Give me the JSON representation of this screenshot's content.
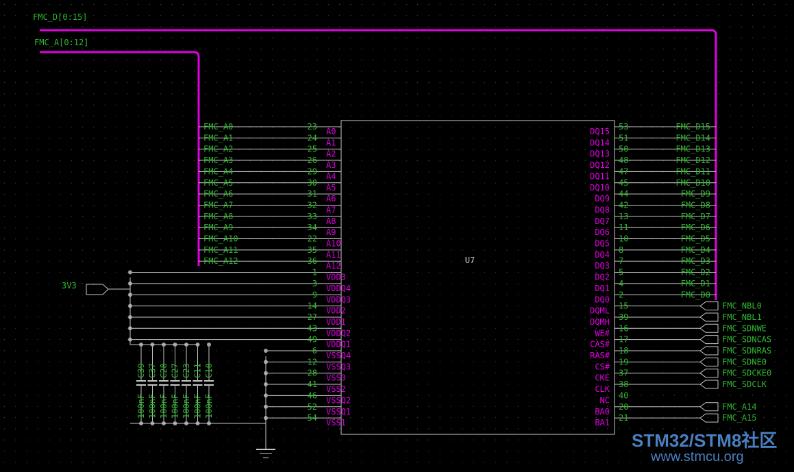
{
  "buses": {
    "data_bus_label": "FMC_D[0:15]",
    "addr_bus_label": "FMC_A[0:12]"
  },
  "power_label": "3V3",
  "chip": {
    "ref": "U7",
    "left_pins": [
      {
        "net": "FMC_A0",
        "num": "23",
        "name": "A0"
      },
      {
        "net": "FMC_A1",
        "num": "24",
        "name": "A1"
      },
      {
        "net": "FMC_A2",
        "num": "25",
        "name": "A2"
      },
      {
        "net": "FMC_A3",
        "num": "26",
        "name": "A3"
      },
      {
        "net": "FMC_A4",
        "num": "29",
        "name": "A4"
      },
      {
        "net": "FMC_A5",
        "num": "30",
        "name": "A5"
      },
      {
        "net": "FMC_A6",
        "num": "31",
        "name": "A6"
      },
      {
        "net": "FMC_A7",
        "num": "32",
        "name": "A7"
      },
      {
        "net": "FMC_A8",
        "num": "33",
        "name": "A8"
      },
      {
        "net": "FMC_A9",
        "num": "34",
        "name": "A9"
      },
      {
        "net": "FMC_A10",
        "num": "22",
        "name": "A10"
      },
      {
        "net": "FMC_A11",
        "num": "35",
        "name": "A11"
      },
      {
        "net": "FMC_A12",
        "num": "36",
        "name": "A12"
      },
      {
        "net": "",
        "num": "1",
        "name": "VDD3"
      },
      {
        "net": "",
        "num": "3",
        "name": "VDDQ4"
      },
      {
        "net": "",
        "num": "9",
        "name": "VDDQ3"
      },
      {
        "net": "",
        "num": "14",
        "name": "VDD2"
      },
      {
        "net": "",
        "num": "27",
        "name": "VDD1"
      },
      {
        "net": "",
        "num": "43",
        "name": "VDDQ2"
      },
      {
        "net": "",
        "num": "49",
        "name": "VDDQ1"
      },
      {
        "net": "",
        "num": "6",
        "name": "VSSQ4"
      },
      {
        "net": "",
        "num": "12",
        "name": "VSSQ3"
      },
      {
        "net": "",
        "num": "28",
        "name": "VSS3"
      },
      {
        "net": "",
        "num": "41",
        "name": "VSS2"
      },
      {
        "net": "",
        "num": "46",
        "name": "VSSQ2"
      },
      {
        "net": "",
        "num": "52",
        "name": "VSSQ1"
      },
      {
        "net": "",
        "num": "54",
        "name": "VSS1"
      }
    ],
    "right_pins": [
      {
        "net": "FMC_D15",
        "num": "53",
        "name": "DQ15"
      },
      {
        "net": "FMC_D14",
        "num": "51",
        "name": "DQ14"
      },
      {
        "net": "FMC_D13",
        "num": "50",
        "name": "DQ13"
      },
      {
        "net": "FMC_D12",
        "num": "48",
        "name": "DQ12"
      },
      {
        "net": "FMC_D11",
        "num": "47",
        "name": "DQ11"
      },
      {
        "net": "FMC_D10",
        "num": "45",
        "name": "DQ10"
      },
      {
        "net": "FMC_D9",
        "num": "44",
        "name": "DQ9"
      },
      {
        "net": "FMC_D8",
        "num": "42",
        "name": "DQ8"
      },
      {
        "net": "FMC_D7",
        "num": "13",
        "name": "DQ7"
      },
      {
        "net": "FMC_D6",
        "num": "11",
        "name": "DQ6"
      },
      {
        "net": "FMC_D5",
        "num": "10",
        "name": "DQ5"
      },
      {
        "net": "FMC_D4",
        "num": "8",
        "name": "DQ4"
      },
      {
        "net": "FMC_D3",
        "num": "7",
        "name": "DQ3"
      },
      {
        "net": "FMC_D2",
        "num": "5",
        "name": "DQ2"
      },
      {
        "net": "FMC_D1",
        "num": "4",
        "name": "DQ1"
      },
      {
        "net": "FMC_D0",
        "num": "2",
        "name": "DQ0"
      },
      {
        "net": "",
        "num": "15",
        "name": "DQML"
      },
      {
        "net": "",
        "num": "39",
        "name": "DQMH"
      },
      {
        "net": "",
        "num": "16",
        "name": "WE#"
      },
      {
        "net": "",
        "num": "17",
        "name": "CAS#"
      },
      {
        "net": "",
        "num": "18",
        "name": "RAS#"
      },
      {
        "net": "",
        "num": "19",
        "name": "CS#"
      },
      {
        "net": "",
        "num": "37",
        "name": "CKE"
      },
      {
        "net": "",
        "num": "38",
        "name": "CLK"
      },
      {
        "net": "",
        "num": "40",
        "name": "NC"
      },
      {
        "net": "",
        "num": "20",
        "name": "BA0"
      },
      {
        "net": "",
        "num": "21",
        "name": "BA1"
      }
    ]
  },
  "ports": [
    {
      "label": "FMC_NBL0"
    },
    {
      "label": "FMC_NBL1"
    },
    {
      "label": "FMC_SDNWE"
    },
    {
      "label": "FMC_SDNCAS"
    },
    {
      "label": "FMC_SDNRAS"
    },
    {
      "label": "FMC_SDNE0"
    },
    {
      "label": "FMC_SDCKE0"
    },
    {
      "label": "FMC_SDCLK"
    },
    {
      "label": "FMC_A14"
    },
    {
      "label": "FMC_A15"
    }
  ],
  "capacitors": [
    {
      "ref": "C39",
      "value": "100nF"
    },
    {
      "ref": "C37",
      "value": "100nF"
    },
    {
      "ref": "C28",
      "value": "100nF"
    },
    {
      "ref": "C27",
      "value": "100nF"
    },
    {
      "ref": "C23",
      "value": "100nF"
    },
    {
      "ref": "C11",
      "value": "100nF"
    },
    {
      "ref": "C10",
      "value": "100nF"
    }
  ],
  "watermark": {
    "line1": "STM32/STM8社区",
    "line2": "www.stmcu.org"
  },
  "colors": {
    "background": "#000000",
    "net_label": "#2eb82e",
    "pin_name": "#e000e0",
    "bus": "#e000e0",
    "wire": "#c8c8c8",
    "junction": "#a0a0a0"
  }
}
